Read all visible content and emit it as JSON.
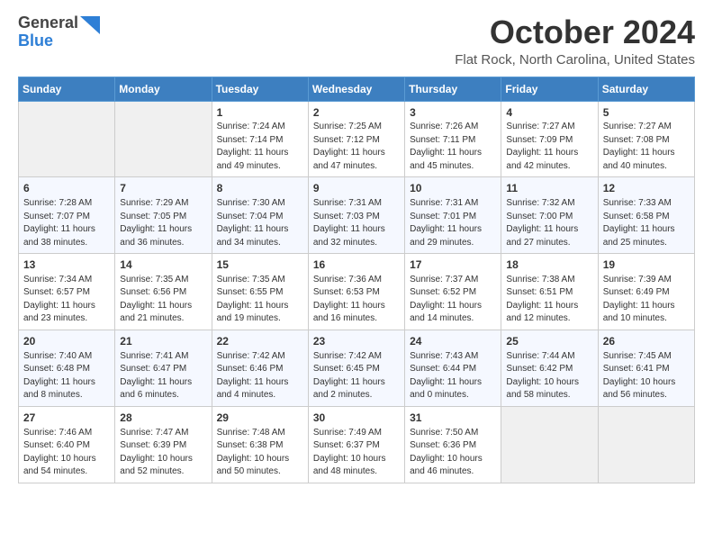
{
  "header": {
    "logo_general": "General",
    "logo_blue": "Blue",
    "title": "October 2024",
    "subtitle": "Flat Rock, North Carolina, United States"
  },
  "days_of_week": [
    "Sunday",
    "Monday",
    "Tuesday",
    "Wednesday",
    "Thursday",
    "Friday",
    "Saturday"
  ],
  "weeks": [
    [
      {
        "num": "",
        "info": ""
      },
      {
        "num": "",
        "info": ""
      },
      {
        "num": "1",
        "info": "Sunrise: 7:24 AM\nSunset: 7:14 PM\nDaylight: 11 hours and 49 minutes."
      },
      {
        "num": "2",
        "info": "Sunrise: 7:25 AM\nSunset: 7:12 PM\nDaylight: 11 hours and 47 minutes."
      },
      {
        "num": "3",
        "info": "Sunrise: 7:26 AM\nSunset: 7:11 PM\nDaylight: 11 hours and 45 minutes."
      },
      {
        "num": "4",
        "info": "Sunrise: 7:27 AM\nSunset: 7:09 PM\nDaylight: 11 hours and 42 minutes."
      },
      {
        "num": "5",
        "info": "Sunrise: 7:27 AM\nSunset: 7:08 PM\nDaylight: 11 hours and 40 minutes."
      }
    ],
    [
      {
        "num": "6",
        "info": "Sunrise: 7:28 AM\nSunset: 7:07 PM\nDaylight: 11 hours and 38 minutes."
      },
      {
        "num": "7",
        "info": "Sunrise: 7:29 AM\nSunset: 7:05 PM\nDaylight: 11 hours and 36 minutes."
      },
      {
        "num": "8",
        "info": "Sunrise: 7:30 AM\nSunset: 7:04 PM\nDaylight: 11 hours and 34 minutes."
      },
      {
        "num": "9",
        "info": "Sunrise: 7:31 AM\nSunset: 7:03 PM\nDaylight: 11 hours and 32 minutes."
      },
      {
        "num": "10",
        "info": "Sunrise: 7:31 AM\nSunset: 7:01 PM\nDaylight: 11 hours and 29 minutes."
      },
      {
        "num": "11",
        "info": "Sunrise: 7:32 AM\nSunset: 7:00 PM\nDaylight: 11 hours and 27 minutes."
      },
      {
        "num": "12",
        "info": "Sunrise: 7:33 AM\nSunset: 6:58 PM\nDaylight: 11 hours and 25 minutes."
      }
    ],
    [
      {
        "num": "13",
        "info": "Sunrise: 7:34 AM\nSunset: 6:57 PM\nDaylight: 11 hours and 23 minutes."
      },
      {
        "num": "14",
        "info": "Sunrise: 7:35 AM\nSunset: 6:56 PM\nDaylight: 11 hours and 21 minutes."
      },
      {
        "num": "15",
        "info": "Sunrise: 7:35 AM\nSunset: 6:55 PM\nDaylight: 11 hours and 19 minutes."
      },
      {
        "num": "16",
        "info": "Sunrise: 7:36 AM\nSunset: 6:53 PM\nDaylight: 11 hours and 16 minutes."
      },
      {
        "num": "17",
        "info": "Sunrise: 7:37 AM\nSunset: 6:52 PM\nDaylight: 11 hours and 14 minutes."
      },
      {
        "num": "18",
        "info": "Sunrise: 7:38 AM\nSunset: 6:51 PM\nDaylight: 11 hours and 12 minutes."
      },
      {
        "num": "19",
        "info": "Sunrise: 7:39 AM\nSunset: 6:49 PM\nDaylight: 11 hours and 10 minutes."
      }
    ],
    [
      {
        "num": "20",
        "info": "Sunrise: 7:40 AM\nSunset: 6:48 PM\nDaylight: 11 hours and 8 minutes."
      },
      {
        "num": "21",
        "info": "Sunrise: 7:41 AM\nSunset: 6:47 PM\nDaylight: 11 hours and 6 minutes."
      },
      {
        "num": "22",
        "info": "Sunrise: 7:42 AM\nSunset: 6:46 PM\nDaylight: 11 hours and 4 minutes."
      },
      {
        "num": "23",
        "info": "Sunrise: 7:42 AM\nSunset: 6:45 PM\nDaylight: 11 hours and 2 minutes."
      },
      {
        "num": "24",
        "info": "Sunrise: 7:43 AM\nSunset: 6:44 PM\nDaylight: 11 hours and 0 minutes."
      },
      {
        "num": "25",
        "info": "Sunrise: 7:44 AM\nSunset: 6:42 PM\nDaylight: 10 hours and 58 minutes."
      },
      {
        "num": "26",
        "info": "Sunrise: 7:45 AM\nSunset: 6:41 PM\nDaylight: 10 hours and 56 minutes."
      }
    ],
    [
      {
        "num": "27",
        "info": "Sunrise: 7:46 AM\nSunset: 6:40 PM\nDaylight: 10 hours and 54 minutes."
      },
      {
        "num": "28",
        "info": "Sunrise: 7:47 AM\nSunset: 6:39 PM\nDaylight: 10 hours and 52 minutes."
      },
      {
        "num": "29",
        "info": "Sunrise: 7:48 AM\nSunset: 6:38 PM\nDaylight: 10 hours and 50 minutes."
      },
      {
        "num": "30",
        "info": "Sunrise: 7:49 AM\nSunset: 6:37 PM\nDaylight: 10 hours and 48 minutes."
      },
      {
        "num": "31",
        "info": "Sunrise: 7:50 AM\nSunset: 6:36 PM\nDaylight: 10 hours and 46 minutes."
      },
      {
        "num": "",
        "info": ""
      },
      {
        "num": "",
        "info": ""
      }
    ]
  ]
}
